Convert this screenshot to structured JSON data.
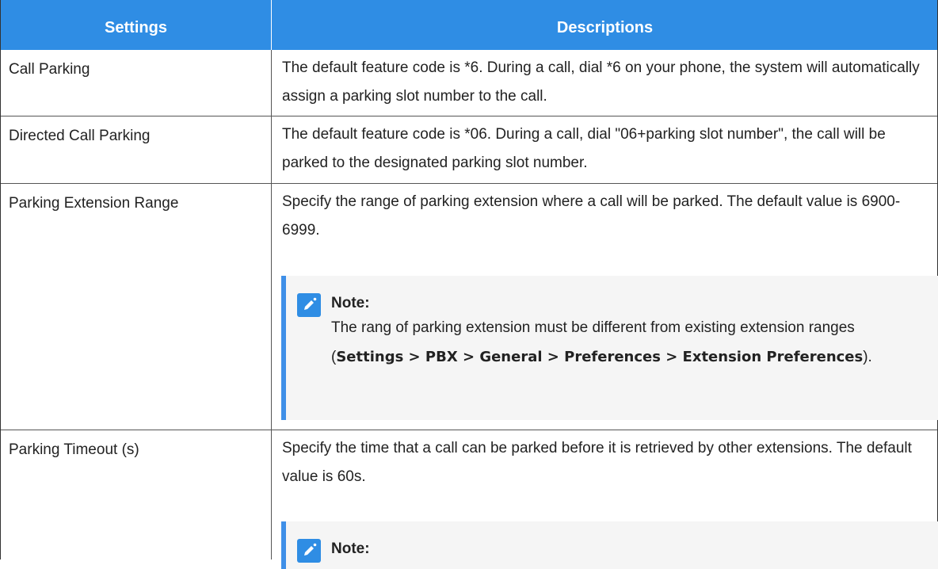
{
  "table": {
    "header": {
      "settings": "Settings",
      "descriptions": "Descriptions"
    },
    "rows": [
      {
        "setting": "Call Parking",
        "description": "The default feature code is *6. During a call, dial *6 on your phone, the system will automatically assign a parking slot number to the call."
      },
      {
        "setting": "Directed Call Parking",
        "description": "The default feature code is *06. During a call, dial \"06+parking slot number\", the call will be parked to the designated parking slot number."
      },
      {
        "setting": "Parking Extension Range",
        "description": "Specify the range of parking extension where a call will be parked. The default value is 6900-6999.",
        "note": {
          "title": "Note:",
          "text_before": "The rang of parking extension must be different from existing extension ranges (",
          "bold_path": "Settings > PBX > General > Preferences > Extension Preferences",
          "text_after": ")."
        }
      },
      {
        "setting": "Parking Timeout (s)",
        "description": "Specify the time that a call can be parked before it is retrieved by other extensions. The default value is 60s.",
        "note": {
          "title": "Note:"
        }
      }
    ]
  },
  "colors": {
    "header_bg": "#2f8de4",
    "note_accent": "#3f8fe8",
    "note_bg": "#f5f5f5"
  },
  "icons": {
    "note_icon": "pencil-edit-icon"
  }
}
